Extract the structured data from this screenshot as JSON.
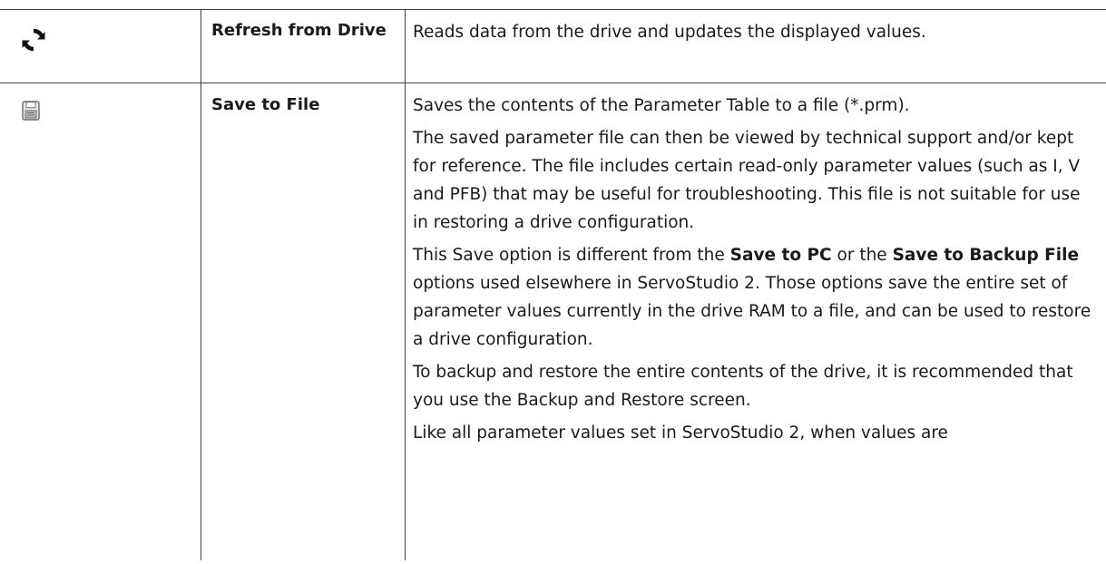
{
  "rows": [
    {
      "icon": "refresh-icon",
      "name": "Refresh from Drive",
      "description": "Reads data from the drive and updates the displayed values."
    },
    {
      "icon": "save-floppy-icon",
      "name": "Save to File",
      "p1": "Saves the contents of the Parameter Table to a file (*.prm).",
      "p2": "The saved parameter file can then be viewed by technical support and/or kept for reference. The file includes certain read-only parameter values (such as I, V and PFB) that may be useful for troubleshooting. This file is not suitable for use in restoring a drive configuration.",
      "p3": {
        "a": "This Save option is different from the ",
        "b": "Save to PC",
        "c": " or the ",
        "d": "Save to Backup File",
        "e": " options used elsewhere in ServoStudio 2. Those options save the entire set of parameter values currently in the drive RAM to a file, and can be used to restore a drive configuration."
      },
      "p4": "To backup and restore the entire contents of the drive, it is recommended that you use the Backup and Restore screen.",
      "p5": "Like all parameter values set in ServoStudio 2, when values are"
    }
  ]
}
